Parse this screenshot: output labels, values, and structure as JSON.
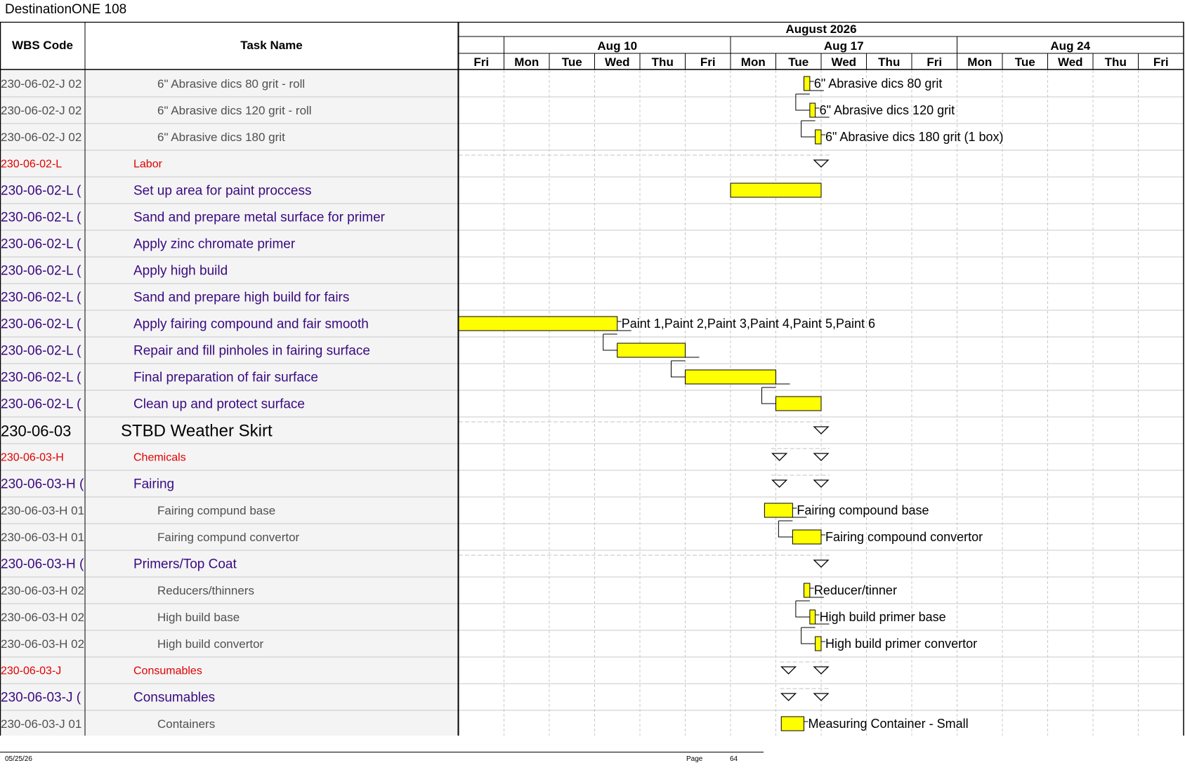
{
  "document": {
    "title": "DestinationONE 108",
    "footer_date": "05/25/26",
    "footer_page_label": "Page",
    "footer_page_number": "64"
  },
  "columns": {
    "wbs_header": "WBS Code",
    "task_header": "Task Name"
  },
  "timescale": {
    "month_label": "August 2026",
    "weeks": [
      {
        "label": "Aug 10",
        "start_day_index": 1
      },
      {
        "label": "Aug 17",
        "start_day_index": 6
      },
      {
        "label": "Aug 24",
        "start_day_index": 11
      }
    ],
    "days": [
      "Fri",
      "Mon",
      "Tue",
      "Wed",
      "Thu",
      "Fri",
      "Mon",
      "Tue",
      "Wed",
      "Thu",
      "Fri",
      "Mon",
      "Tue",
      "Wed",
      "Thu",
      "Fri"
    ]
  },
  "colors": {
    "bar_fill": "#ffff00",
    "level_red": "#e00000",
    "level_purple": "#3a0a80",
    "level_gray": "#505050",
    "level_black": "#000000",
    "col_shade": "#f4f4f4",
    "grid_line": "#c8c8c8"
  },
  "rows": [
    {
      "wbs": "230-06-02-J 02",
      "task": "6\" Abrasive dics 80 grit - roll",
      "style": "gray",
      "indent": 3,
      "bar": {
        "start": 7.62,
        "end": 7.75,
        "label": "6\" Abrasive dics 80 grit"
      }
    },
    {
      "wbs": "230-06-02-J 02",
      "task": "6\" Abrasive dics 120 grit - roll",
      "style": "gray",
      "indent": 3,
      "bar": {
        "start": 7.75,
        "end": 7.87,
        "label": "6\" Abrasive dics 120 grit"
      },
      "link_from_prev": true
    },
    {
      "wbs": "230-06-02-J 02",
      "task": "6\" Abrasive dics 180 grit",
      "style": "gray",
      "indent": 3,
      "bar": {
        "start": 7.87,
        "end": 8.0,
        "label": "6\" Abrasive dics 180 grit (1 box)"
      },
      "link_from_prev": true
    },
    {
      "wbs": "230-06-02-L",
      "task": "Labor",
      "style": "red",
      "indent": 2,
      "summary": {
        "markers": [
          8.0
        ],
        "dashed": true
      }
    },
    {
      "wbs": "230-06-02-L (",
      "task": "Set up area for paint proccess",
      "style": "purple",
      "indent": 2,
      "bar": {
        "start": 6.0,
        "end": 8.0,
        "label": ""
      }
    },
    {
      "wbs": "230-06-02-L (",
      "task": "Sand and prepare metal surface for primer",
      "style": "purple",
      "indent": 2
    },
    {
      "wbs": "230-06-02-L (",
      "task": "Apply zinc chromate primer",
      "style": "purple",
      "indent": 2
    },
    {
      "wbs": "230-06-02-L (",
      "task": "Apply high build",
      "style": "purple",
      "indent": 2
    },
    {
      "wbs": "230-06-02-L (",
      "task": "Sand and prepare high build for fairs",
      "style": "purple",
      "indent": 2
    },
    {
      "wbs": "230-06-02-L (",
      "task": "Apply fairing compound and fair smooth",
      "style": "purple",
      "indent": 2,
      "bar": {
        "start": 0.0,
        "end": 3.5,
        "label": "Paint 1,Paint 2,Paint 3,Paint 4,Paint 5,Paint 6"
      }
    },
    {
      "wbs": "230-06-02-L (",
      "task": "Repair and fill pinholes in fairing surface",
      "style": "purple",
      "indent": 2,
      "bar": {
        "start": 3.5,
        "end": 5.0,
        "label": ""
      },
      "link_from_prev": true
    },
    {
      "wbs": "230-06-02-L (",
      "task": "Final preparation of fair surface",
      "style": "purple",
      "indent": 2,
      "bar": {
        "start": 5.0,
        "end": 7.0,
        "label": ""
      },
      "link_from_prev": true
    },
    {
      "wbs": "230-06-02-L (",
      "task": "Clean up and protect surface",
      "style": "purple",
      "indent": 2,
      "bar": {
        "start": 7.0,
        "end": 8.0,
        "label": ""
      },
      "link_from_prev": true
    },
    {
      "wbs": "230-06-03",
      "task": "STBD Weather Skirt",
      "style": "black",
      "indent": 1,
      "summary": {
        "markers": [
          8.0
        ],
        "dashed": true
      }
    },
    {
      "wbs": "230-06-03-H",
      "task": "Chemicals",
      "style": "red",
      "indent": 2,
      "summary": {
        "markers": [
          7.08,
          8.0
        ],
        "dashed": true
      }
    },
    {
      "wbs": "230-06-03-H (",
      "task": "Fairing",
      "style": "purple",
      "indent": 2,
      "summary": {
        "markers": [
          7.08,
          8.0
        ],
        "dashed": true
      }
    },
    {
      "wbs": "230-06-03-H 01",
      "task": "Fairing compund base",
      "style": "gray",
      "indent": 3,
      "bar": {
        "start": 6.75,
        "end": 7.37,
        "label": "Fairing compound base"
      }
    },
    {
      "wbs": "230-06-03-H 01",
      "task": "Fairing compund convertor",
      "style": "gray",
      "indent": 3,
      "bar": {
        "start": 7.37,
        "end": 8.0,
        "label": "Fairing compound convertor"
      },
      "link_from_prev": true
    },
    {
      "wbs": "230-06-03-H (",
      "task": "Primers/Top Coat",
      "style": "purple",
      "indent": 2,
      "summary": {
        "markers": [
          8.0
        ],
        "dashed": true
      }
    },
    {
      "wbs": "230-06-03-H 02",
      "task": "Reducers/thinners",
      "style": "gray",
      "indent": 3,
      "bar": {
        "start": 7.62,
        "end": 7.75,
        "label": "Reducer/tinner"
      }
    },
    {
      "wbs": "230-06-03-H 02",
      "task": "High build base",
      "style": "gray",
      "indent": 3,
      "bar": {
        "start": 7.75,
        "end": 7.87,
        "label": "High build primer base"
      },
      "link_from_prev": true
    },
    {
      "wbs": "230-06-03-H 02",
      "task": "High build convertor",
      "style": "gray",
      "indent": 3,
      "bar": {
        "start": 7.87,
        "end": 8.0,
        "label": "High build primer convertor"
      },
      "link_from_prev": true
    },
    {
      "wbs": "230-06-03-J",
      "task": "Consumables",
      "style": "red",
      "indent": 2,
      "summary": {
        "markers": [
          7.28,
          8.0
        ],
        "dashed": true
      }
    },
    {
      "wbs": "230-06-03-J (",
      "task": "Consumables",
      "style": "purple",
      "indent": 2,
      "summary": {
        "markers": [
          7.28,
          8.0
        ],
        "dashed": true
      }
    },
    {
      "wbs": "230-06-03-J 01",
      "task": "Containers",
      "style": "gray",
      "indent": 3,
      "bar": {
        "start": 7.12,
        "end": 7.62,
        "label": "Measuring Container - Small"
      }
    }
  ]
}
